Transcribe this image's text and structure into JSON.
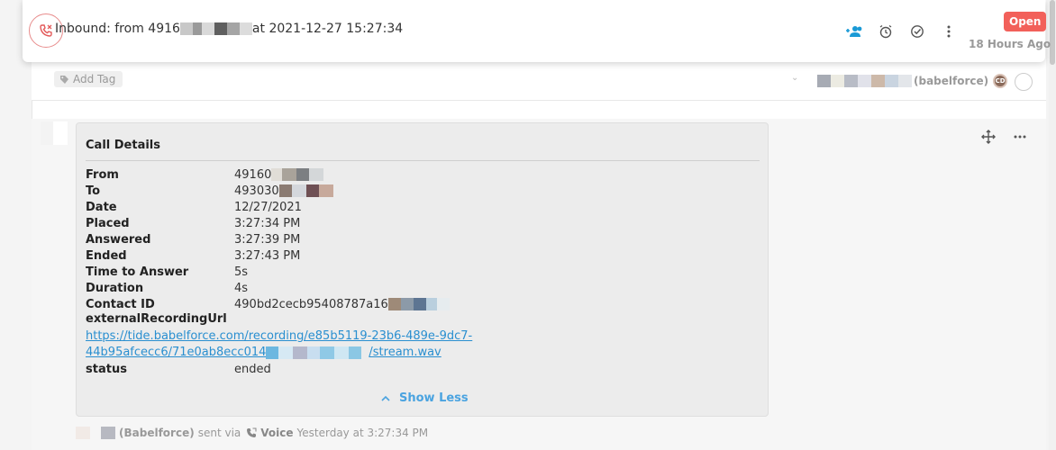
{
  "header": {
    "title_prefix": "Inbound: from 4916",
    "title_suffix": "at 2021-12-27 15:27:34",
    "status": "Open",
    "age": "18 Hours Ago",
    "actions": [
      "assign-users-icon",
      "snooze-clock-icon",
      "resolve-check-icon",
      "more-vertical-icon"
    ],
    "accent_color": "#1a9ad6",
    "status_color": "#f2605a"
  },
  "tag_bar": {
    "add_tag_label": "Add Tag",
    "assignee_org": "(babelforce)",
    "assignee_initials": "CD"
  },
  "call_details": {
    "title": "Call Details",
    "rows": [
      {
        "label": "From",
        "value": "49160"
      },
      {
        "label": "To",
        "value": "493030"
      },
      {
        "label": "Date",
        "value": "12/27/2021"
      },
      {
        "label": "Placed",
        "value": "3:27:34 PM"
      },
      {
        "label": "Answered",
        "value": "3:27:39 PM"
      },
      {
        "label": "Ended",
        "value": "3:27:43 PM"
      },
      {
        "label": "Time to Answer",
        "value": "5s"
      },
      {
        "label": "Duration",
        "value": "4s"
      },
      {
        "label": "Contact ID",
        "value": "490bd2cecb95408787a16"
      }
    ],
    "recording_label": "externalRecordingUrl",
    "recording_url_line1": "https://tide.babelforce.com/recording/e85b5119-23b6-489e-9dc7-",
    "recording_url_line2_prefix": "44b95afcecc6/71e0ab8ecc014",
    "recording_url_line2_suffix": "/stream.wav",
    "status_label": "status",
    "status_value": "ended",
    "toggle_label": "Show Less"
  },
  "footer": {
    "org": "(Babelforce)",
    "sent_via": "sent via",
    "channel": "Voice",
    "time": "Yesterday at 3:27:34 PM"
  }
}
